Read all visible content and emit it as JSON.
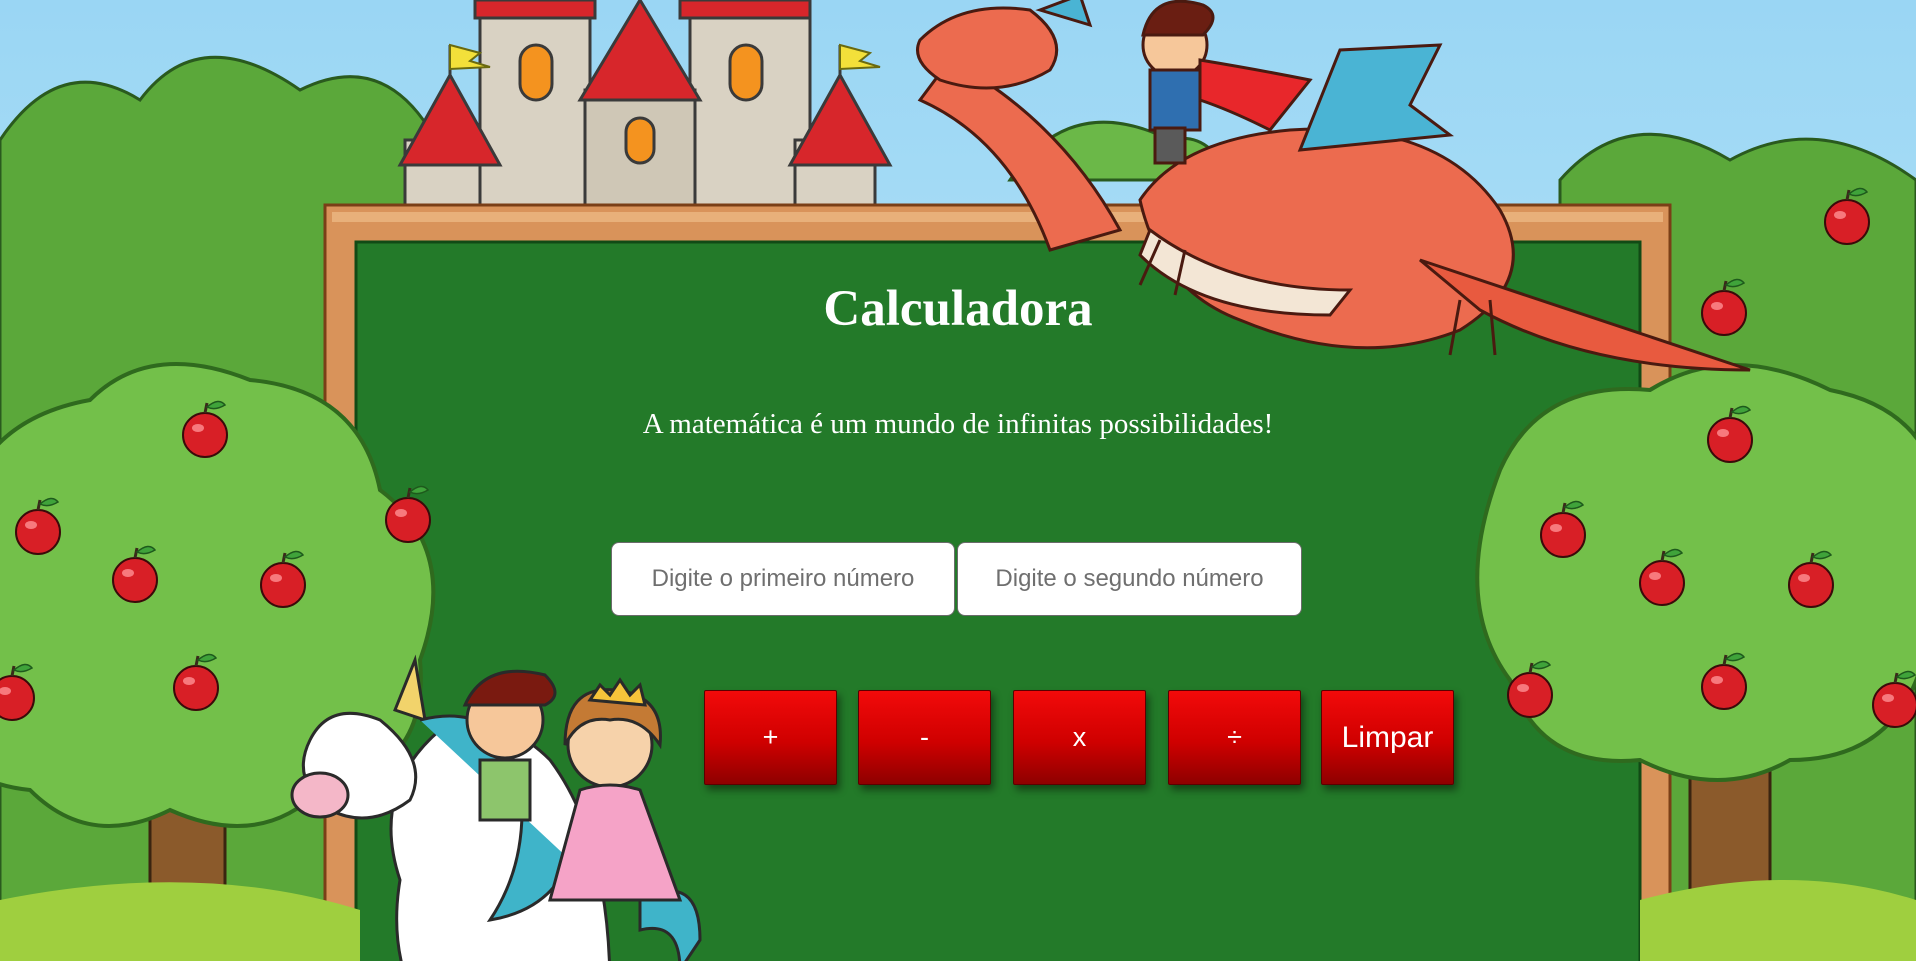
{
  "title": "Calculadora",
  "subtitle": "A matemática é um mundo de infinitas possibilidades!",
  "inputs": {
    "first_placeholder": "Digite o primeiro número",
    "second_placeholder": "Digite o segundo número"
  },
  "buttons": {
    "add": "+",
    "subtract": "-",
    "multiply": "x",
    "divide": "÷",
    "clear": "Limpar"
  },
  "colors": {
    "sky": "#a6dcf5",
    "chalkboard": "#237a29",
    "board_frame": "#d9935a",
    "button_red": "#e00000",
    "tree_green": "#73c04a",
    "apple_red": "#d81f26"
  }
}
